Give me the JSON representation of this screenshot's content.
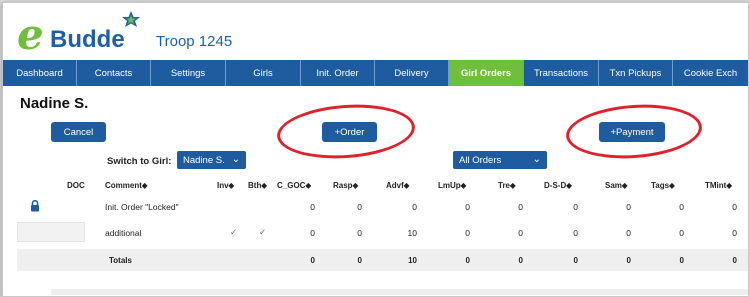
{
  "app": {
    "logo_text": "Budde",
    "logo_letter": "e",
    "troop": "Troop 1245"
  },
  "nav": [
    {
      "label": "Dashboard",
      "active": false
    },
    {
      "label": "Contacts",
      "active": false
    },
    {
      "label": "Settings",
      "active": false
    },
    {
      "label": "Girls",
      "active": false
    },
    {
      "label": "Init. Order",
      "active": false
    },
    {
      "label": "Delivery",
      "active": false
    },
    {
      "label": "Girl Orders",
      "active": true
    },
    {
      "label": "Transactions",
      "active": false
    },
    {
      "label": "Txn Pickups",
      "active": false
    },
    {
      "label": "Cookie Exch",
      "active": false
    }
  ],
  "page": {
    "girl_name": "Nadine S."
  },
  "buttons": {
    "cancel": "Cancel",
    "order": "+Order",
    "payment": "+Payment"
  },
  "switch": {
    "label": "Switch to Girl:",
    "selected": "Nadine S."
  },
  "filter": {
    "selected": "All Orders"
  },
  "colors": {
    "nav_bg": "#1e5c9f",
    "active_tab": "#6fbe3c",
    "highlight_ring": "#e0202a"
  },
  "table": {
    "headers": [
      "DOC",
      "Comment⬥",
      "Inv⬥",
      "Bth⬥",
      "C_GOC⬥",
      "Rasp⬥",
      "Advf⬥",
      "LmUp⬥",
      "Tre⬥",
      "D-S-D⬥",
      "Sam⬥",
      "Tags⬥",
      "TMint⬥"
    ],
    "rows": [
      {
        "comment": "Init. Order \"Locked\"",
        "inv": "",
        "bth": "",
        "values": [
          "0",
          "0",
          "0",
          "0",
          "0",
          "0",
          "0",
          "0",
          "0"
        ]
      },
      {
        "comment": "additional",
        "inv": "✓",
        "bth": "✓",
        "values": [
          "0",
          "0",
          "10",
          "0",
          "0",
          "0",
          "0",
          "0",
          "0"
        ]
      }
    ],
    "totals": {
      "label": "Totals",
      "values": [
        "0",
        "0",
        "10",
        "0",
        "0",
        "0",
        "0",
        "0",
        "0"
      ]
    }
  }
}
